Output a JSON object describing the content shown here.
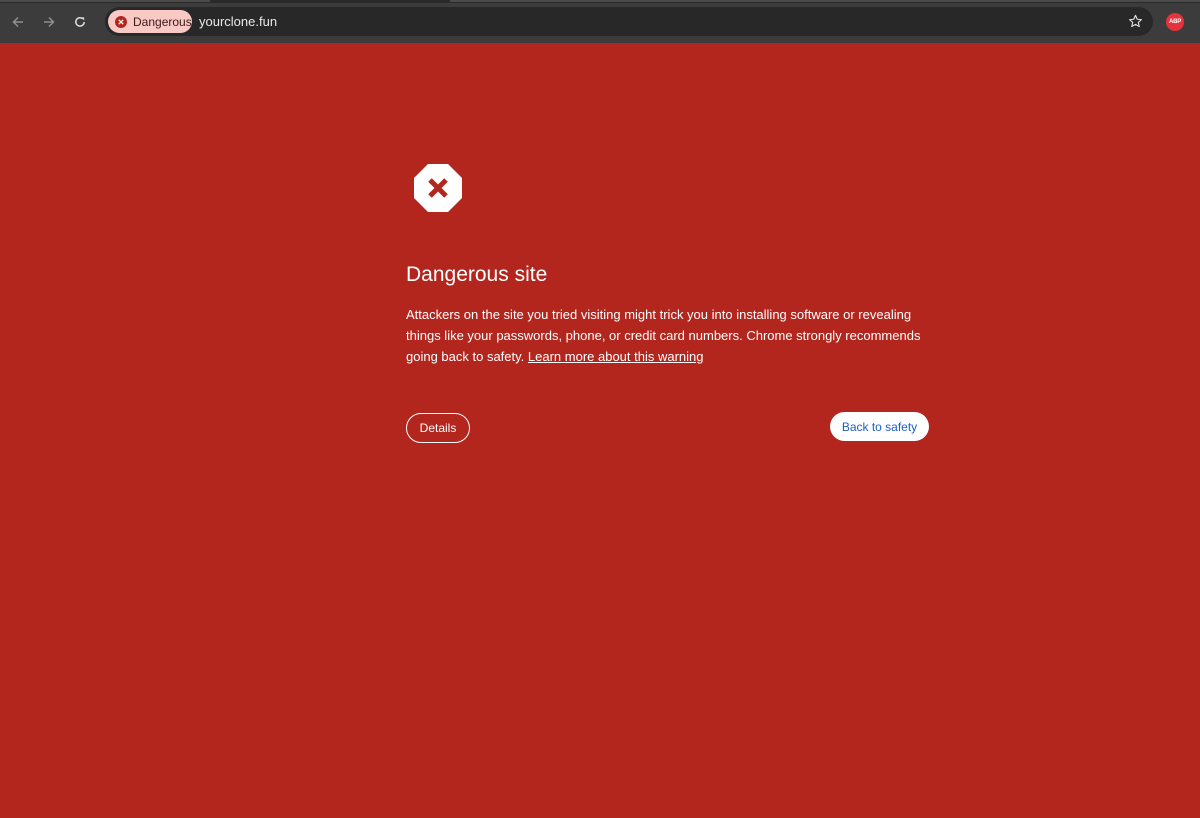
{
  "toolbar": {
    "back_icon": "arrow-left-icon",
    "forward_icon": "arrow-right-icon",
    "reload_icon": "reload-icon",
    "security_chip_label": "Dangerous",
    "url": "yourclone.fun",
    "bookmark_icon": "star-icon",
    "extension_label": "ABP"
  },
  "warning": {
    "title": "Dangerous site",
    "body": "Attackers on the site you tried visiting might trick you into installing software or revealing things like your passwords, phone, or credit card numbers. Chrome strongly recommends going back to safety.",
    "learn_more_link": "Learn more about this warning",
    "details_button": "Details",
    "back_button": "Back to safety"
  },
  "colors": {
    "background": "#b3261e",
    "chip_background": "#f9c9c6",
    "primary_button_text": "#1a5fc8",
    "toolbar": "#3c3c3c"
  }
}
